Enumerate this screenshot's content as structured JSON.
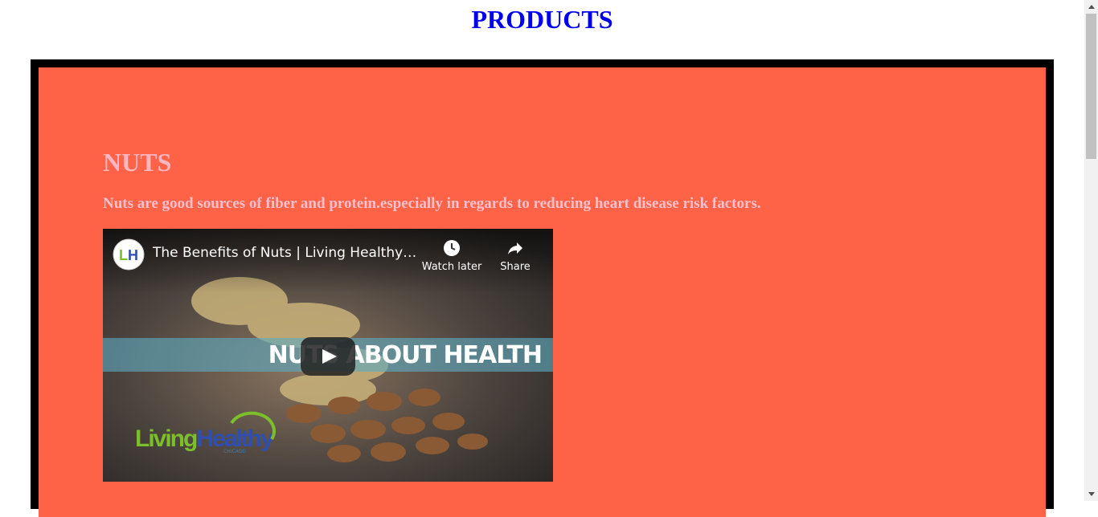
{
  "page": {
    "title": "PRODUCTS"
  },
  "section": {
    "title": "NUTS",
    "description": "Nuts are good sources of fiber and protein.especially in regards to reducing heart disease risk factors."
  },
  "video": {
    "title": "The Benefits of Nuts | Living Healthy C...",
    "watch_later_label": "Watch later",
    "share_label": "Share",
    "banner_text": "NUTS ABOUT HEALTH",
    "channel_initials": "LH",
    "brand_part1": "Living",
    "brand_part2": "Healthy",
    "brand_sub": "CHICAGO",
    "icons": [
      "channel-avatar",
      "clock-icon",
      "share-icon",
      "play-icon"
    ]
  },
  "colors": {
    "title": "#0000ee",
    "frame": "#000000",
    "panel": "#ff6347",
    "section_title": "#ffb6c1"
  }
}
